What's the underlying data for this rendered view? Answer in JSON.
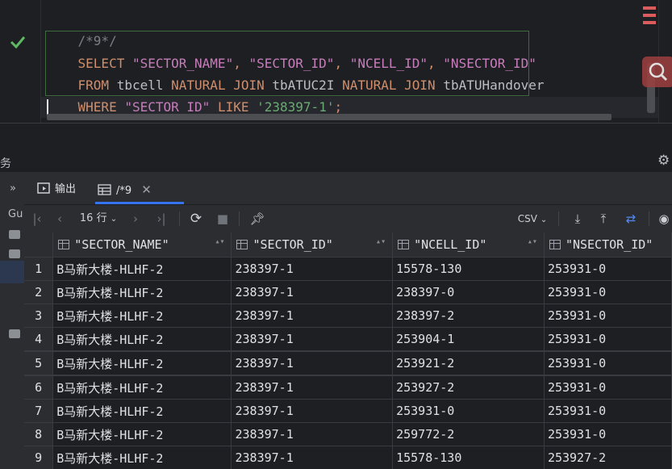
{
  "editor": {
    "lines": {
      "comment": "/*9*/",
      "l1_select": "SELECT",
      "l1_c1": "\"SECTOR_NAME\"",
      "l1_sep1": ", ",
      "l1_c2": "\"SECTOR_ID\"",
      "l1_sep2": ", ",
      "l1_c3": "\"NCELL_ID\"",
      "l1_sep3": ", ",
      "l1_c4": "\"NSECTOR_ID\"",
      "l2_from": "FROM",
      "l2_t1": "tbcell",
      "l2_nj1": "NATURAL JOIN",
      "l2_t2": "tbATUC2I",
      "l2_nj2": "NATURAL JOIN",
      "l2_t3": "tbATUHandover",
      "l3_where": "WHERE",
      "l3_col": "\"SECTOR_ID\"",
      "l3_like": "LIKE",
      "l3_val": "'238397-1'",
      "l3_semi": ";"
    }
  },
  "panel": {
    "header_fragment": "务"
  },
  "services": {
    "chevron": "»",
    "gu_label": "Gu"
  },
  "tabs": [
    {
      "label": "输出",
      "icon": "console-icon"
    },
    {
      "label": "/*9",
      "icon": "table-icon"
    }
  ],
  "toolbar": {
    "row_count": "16 行",
    "export_format": "CSV"
  },
  "grid": {
    "columns": [
      "\"SECTOR_NAME\"",
      "\"SECTOR_ID\"",
      "\"NCELL_ID\"",
      "\"NSECTOR_ID\""
    ],
    "rows": [
      {
        "n": "1",
        "c": [
          "B马新大楼-HLHF-2",
          "238397-1",
          "15578-130",
          "253931-0"
        ]
      },
      {
        "n": "2",
        "c": [
          "B马新大楼-HLHF-2",
          "238397-1",
          "238397-0",
          "253931-0"
        ]
      },
      {
        "n": "3",
        "c": [
          "B马新大楼-HLHF-2",
          "238397-1",
          "238397-2",
          "253931-0"
        ]
      },
      {
        "n": "4",
        "c": [
          "B马新大楼-HLHF-2",
          "238397-1",
          "253904-1",
          "253931-0"
        ]
      },
      {
        "n": "5",
        "c": [
          "B马新大楼-HLHF-2",
          "238397-1",
          "253921-2",
          "253931-0"
        ]
      },
      {
        "n": "6",
        "c": [
          "B马新大楼-HLHF-2",
          "238397-1",
          "253927-2",
          "253931-0"
        ]
      },
      {
        "n": "7",
        "c": [
          "B马新大楼-HLHF-2",
          "238397-1",
          "253931-0",
          "253931-0"
        ]
      },
      {
        "n": "8",
        "c": [
          "B马新大楼-HLHF-2",
          "238397-1",
          "259772-2",
          "253931-0"
        ]
      },
      {
        "n": "9",
        "c": [
          "B马新大楼-HLHF-2",
          "238397-1",
          "15578-130",
          "253927-2"
        ]
      }
    ]
  },
  "colors": {
    "accent": "#3574f0",
    "keyword": "#cf8e6d",
    "string": "#6aab73",
    "success": "#5fb865",
    "error": "#db5c5c"
  }
}
